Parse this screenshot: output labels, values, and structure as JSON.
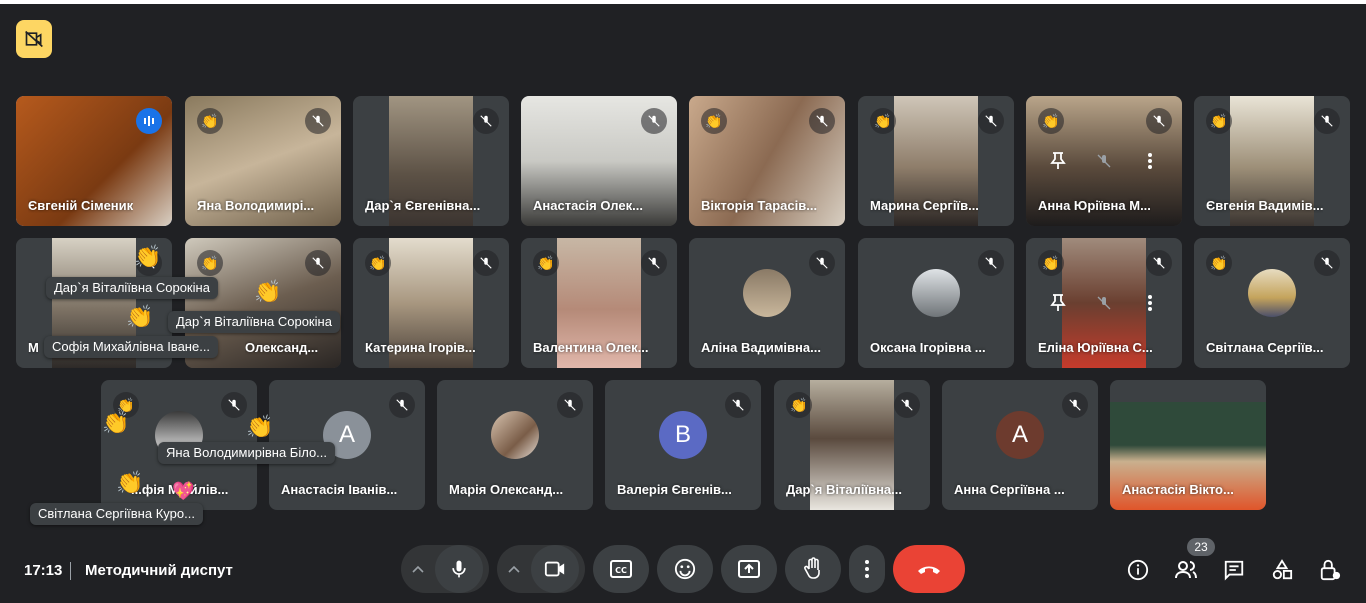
{
  "meeting": {
    "time": "17:13",
    "title": "Методичний диспут",
    "participant_count": "23"
  },
  "tiles": [
    {
      "name": "Євгеній Сіменик",
      "state": "speaking"
    },
    {
      "name": "Яна Володимирі...",
      "state": "muted",
      "hand": true
    },
    {
      "name": "Дар`я Євгенівна...",
      "state": "muted"
    },
    {
      "name": "Анастасія Олек...",
      "state": "muted"
    },
    {
      "name": "Вікторія Тарасів...",
      "state": "muted",
      "hand": true
    },
    {
      "name": "Марина Сергіїв...",
      "state": "muted",
      "hand": true
    },
    {
      "name": "Анна Юріївна М...",
      "state": "muted",
      "hand": true
    },
    {
      "name": "Євгенія Вадимів...",
      "state": "muted",
      "hand": true
    },
    {
      "name": "М",
      "state": "muted",
      "hand": true
    },
    {
      "name": "Олександ...",
      "state": "muted",
      "hand": true
    },
    {
      "name": "Катерина Ігорів...",
      "state": "muted",
      "hand": true
    },
    {
      "name": "Валентина Олек...",
      "state": "muted",
      "hand": true
    },
    {
      "name": "Аліна Вадимівна...",
      "state": "muted"
    },
    {
      "name": "Оксана Ігорівна ...",
      "state": "muted"
    },
    {
      "name": "Еліна Юріївна С...",
      "state": "muted",
      "hand": true
    },
    {
      "name": "Світлана Сергіїв...",
      "state": "muted",
      "hand": true
    },
    {
      "name": "...фія М...йлів...",
      "state": "muted",
      "hand": true
    },
    {
      "name": "Анастасія Іванів...",
      "state": "muted",
      "avatar": "A"
    },
    {
      "name": "Марія Олександ...",
      "state": "muted"
    },
    {
      "name": "Валерія Євгенів...",
      "state": "muted",
      "avatar": "B"
    },
    {
      "name": "Дар`я Віталіївна...",
      "state": "muted",
      "hand": true
    },
    {
      "name": "Анна Сергіївна ...",
      "state": "muted",
      "avatar": "A"
    },
    {
      "name": "Анастасія Вікто...",
      "state": "unmuted"
    }
  ],
  "floating_labels": [
    "Дар`я Віталіївна Сорокіна",
    "Дар`я Віталіївна Сорокіна",
    "Софія Михайлівна Іване...",
    "Яна Володимирівна Біло...",
    "Світлана Сергіївна Куро..."
  ],
  "controls": {
    "mic": "microphone-icon",
    "camera": "camera-icon",
    "captions": "captions-icon",
    "emoji": "emoji-icon",
    "present": "present-icon",
    "raise_hand": "hand-icon",
    "more": "more-icon",
    "leave": "end-call-icon"
  },
  "colors": {
    "background": "#202124",
    "tile": "#3c4043",
    "speaking": "#1a73e8",
    "end_call": "#ea4335",
    "badge": "#fdd663",
    "avatar_b": "#5b6ac4",
    "avatar_a_brown": "#6d3b2e",
    "avatar_a_gray": "#8a9199"
  }
}
